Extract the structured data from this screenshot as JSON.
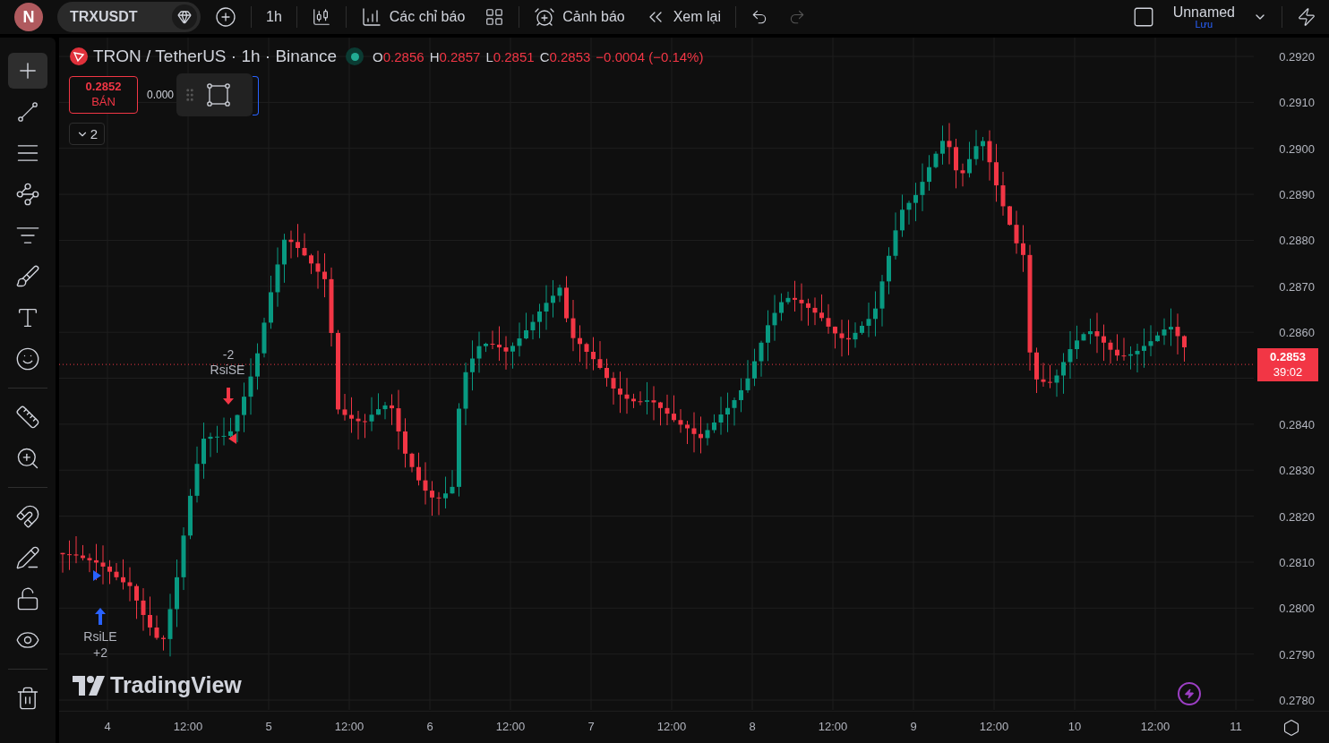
{
  "top_bar": {
    "avatar": "N",
    "symbol": "TRXUSDT",
    "interval": "1h",
    "indicators_label": "Các chỉ báo",
    "alerts_label": "Cảnh báo",
    "replay_label": "Xem lại",
    "layout_name": "Unnamed",
    "save_label": "Lưu"
  },
  "left_toolbar": {
    "groups": [
      [
        {
          "kind": "crosshair",
          "selected": true
        },
        {
          "kind": "trend-line",
          "selected": false
        },
        {
          "kind": "fib",
          "selected": false
        },
        {
          "kind": "pattern",
          "selected": false
        },
        {
          "kind": "forecast",
          "selected": false
        },
        {
          "kind": "brush",
          "selected": false
        },
        {
          "kind": "text",
          "selected": false
        },
        {
          "kind": "emoji",
          "selected": false
        }
      ],
      [
        {
          "kind": "ruler",
          "selected": false
        },
        {
          "kind": "zoom",
          "selected": false
        }
      ],
      [
        {
          "kind": "magnet",
          "selected": false
        },
        {
          "kind": "lock-drawing",
          "selected": false
        },
        {
          "kind": "lock",
          "selected": false
        },
        {
          "kind": "eye",
          "selected": false
        }
      ],
      [
        {
          "kind": "trash",
          "selected": false
        }
      ]
    ]
  },
  "legend": {
    "title": "TRON / TetherUS · 1h · Binance",
    "ohlc": [
      {
        "key": "O",
        "value": "0.2856"
      },
      {
        "key": "H",
        "value": "0.2857"
      },
      {
        "key": "L",
        "value": "0.2851"
      },
      {
        "key": "C",
        "value": "0.2853"
      }
    ],
    "change": "−0.0004 (−0.14%)"
  },
  "trade": {
    "sell_price": "0.2852",
    "sell_label": "BÁN",
    "spread": "0.000"
  },
  "collapse": {
    "count": "2"
  },
  "signals": [
    {
      "kind": "short",
      "qty": "-2",
      "label": "RsiSE"
    },
    {
      "kind": "long",
      "qty": "+2",
      "label": "RsiLE"
    }
  ],
  "logo_text": "TradingView",
  "price_axis": {
    "ticks_above": [
      "0.2920",
      "0.2910",
      "0.2900",
      "0.2890",
      "0.2880",
      "0.2870",
      "0.2860"
    ],
    "ticks_below": [
      "0.2840",
      "0.2830",
      "0.2820",
      "0.2810",
      "0.2800",
      "0.2790",
      "0.2780"
    ],
    "last_price": "0.2853",
    "countdown": "39:02"
  },
  "time_axis": {
    "labels": [
      "4",
      "12:00",
      "5",
      "12:00",
      "6",
      "12:00",
      "7",
      "12:00",
      "8",
      "12:00",
      "9",
      "12:00",
      "10",
      "12:00",
      "11"
    ]
  }
}
